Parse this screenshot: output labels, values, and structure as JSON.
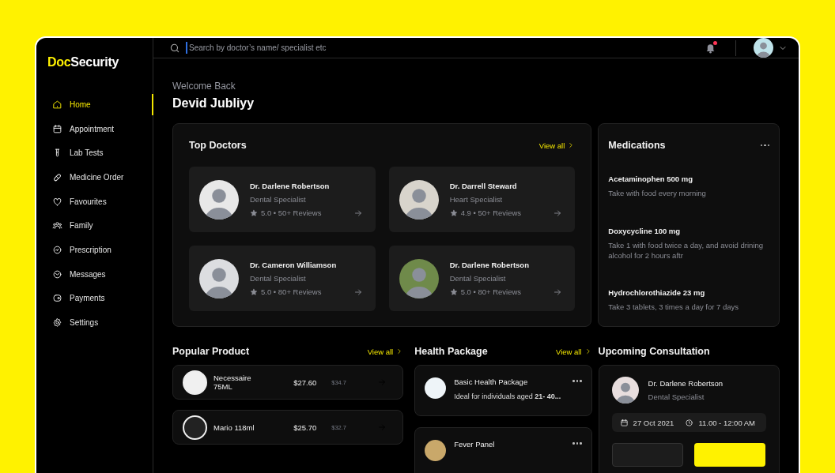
{
  "brand": {
    "part_1": "Doc",
    "part_2": "Security"
  },
  "sidebar": {
    "items": [
      {
        "label": "Home",
        "selected": true
      },
      {
        "label": "Appointment",
        "selected": false
      },
      {
        "label": "Lab Tests",
        "selected": false
      },
      {
        "label": "Medicine Order",
        "selected": false
      },
      {
        "label": "Favourites",
        "selected": false
      },
      {
        "label": "Family",
        "selected": false
      },
      {
        "label": "Prescription",
        "selected": false
      },
      {
        "label": "Messages",
        "selected": false
      },
      {
        "label": "Payments",
        "selected": false
      },
      {
        "label": "Settings",
        "selected": false
      }
    ]
  },
  "header": {
    "search": {
      "placeholder": "Search by doctor’s name/ specialist etc"
    },
    "notification_unread": true
  },
  "welcome": {
    "greeting": "Welcome Back",
    "name": "Devid Jubliyy"
  },
  "top_doctors": {
    "title": "Top Doctors",
    "view_all": "View all",
    "doctors": [
      {
        "name": "Dr. Darlene Robertson",
        "specialty": "Dental Specialist",
        "rating": "5.0 • 50+ Reviews"
      },
      {
        "name": "Dr. Darrell Steward",
        "specialty": "Heart Specialist",
        "rating": "4.9 • 50+ Reviews"
      },
      {
        "name": "Dr. Cameron Williamson",
        "specialty": "Dental Specialist",
        "rating": "5.0 • 80+ Reviews"
      },
      {
        "name": "Dr. Darlene Robertson",
        "specialty": "Dental Specialist",
        "rating": "5.0 • 80+ Reviews"
      }
    ]
  },
  "medications": {
    "title": "Medications",
    "items": [
      {
        "name": "Acetaminophen 500 mg",
        "instructions": "Take with food every morning"
      },
      {
        "name": "Doxycycline 100 mg",
        "instructions": "Take 1 with food twice a day, and avoid drining alcohol for 2 hours aftr"
      },
      {
        "name": "Hydrochlorothiazide 23 mg",
        "instructions": "Take 3 tablets, 3 times a day for 7 days"
      }
    ]
  },
  "popular_product": {
    "title": "Popular Product",
    "view_all": "View all",
    "products": [
      {
        "name": "Necessaire 75ML",
        "price": "$27.60",
        "old_price": "$34.7"
      },
      {
        "name": "Mario 118ml",
        "price": "$25.70",
        "old_price": "$32.7"
      }
    ]
  },
  "health_package": {
    "title": "Health Package",
    "view_all": "View all",
    "packages": [
      {
        "name": "Basic Health Package",
        "description": "Ideal for individuals aged **21- 40...**"
      },
      {
        "name": "Fever Panel"
      }
    ]
  },
  "upcoming_consultation": {
    "title": "Upcoming Consultation",
    "doctor": "Dr. Darlene Robertson",
    "specialty": "Dental Specialist",
    "date": "27 Oct 2021",
    "time": "11.00 - 12:00 AM"
  }
}
